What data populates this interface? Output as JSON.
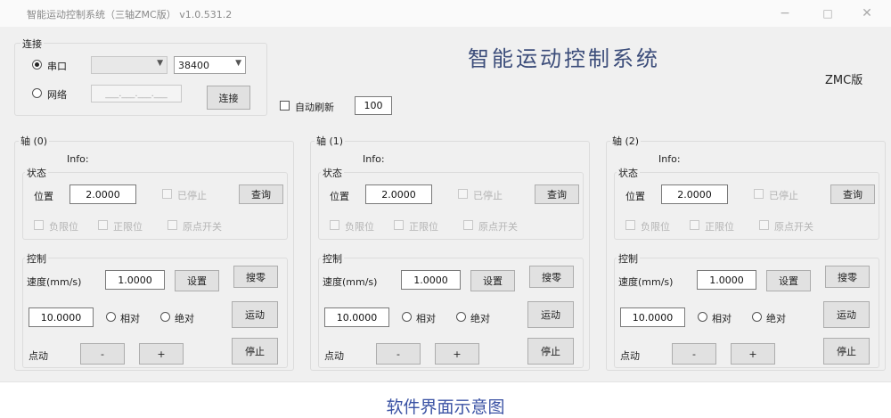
{
  "window": {
    "title": "智能运动控制系统（三轴ZMC版） v1.0.531.2",
    "minimize": "−",
    "maximize": "□",
    "close": "✕"
  },
  "header": {
    "system_name": "智能运动控制系统",
    "edition": "ZMC版"
  },
  "connection": {
    "group_label": "连接",
    "serial_label": "串口",
    "serial_selected": true,
    "port_value": "",
    "baud_value": "38400",
    "network_label": "网络",
    "ip_placeholder": "___.___.___.___",
    "connect_button": "连接"
  },
  "auto_refresh": {
    "label": "自动刷新",
    "checked": false,
    "interval": "100"
  },
  "axes": [
    {
      "title": "轴 (0)",
      "info_label": "Info:",
      "status_label": "状态",
      "position_label": "位置",
      "position_value": "2.0000",
      "stopped_label": "已停止",
      "query_button": "查询",
      "neg_limit_label": "负限位",
      "pos_limit_label": "正限位",
      "origin_switch_label": "原点开关",
      "control_label": "控制",
      "speed_label": "速度(mm/s)",
      "speed_value": "1.0000",
      "set_button": "设置",
      "home_button": "搜零",
      "distance_value": "10.0000",
      "relative_label": "相对",
      "absolute_label": "绝对",
      "move_button": "运动",
      "jog_label": "点动",
      "jog_minus": "-",
      "jog_plus": "+",
      "stop_button": "停止"
    },
    {
      "title": "轴 (1)",
      "info_label": "Info:",
      "status_label": "状态",
      "position_label": "位置",
      "position_value": "2.0000",
      "stopped_label": "已停止",
      "query_button": "查询",
      "neg_limit_label": "负限位",
      "pos_limit_label": "正限位",
      "origin_switch_label": "原点开关",
      "control_label": "控制",
      "speed_label": "速度(mm/s)",
      "speed_value": "1.0000",
      "set_button": "设置",
      "home_button": "搜零",
      "distance_value": "10.0000",
      "relative_label": "相对",
      "absolute_label": "绝对",
      "move_button": "运动",
      "jog_label": "点动",
      "jog_minus": "-",
      "jog_plus": "+",
      "stop_button": "停止"
    },
    {
      "title": "轴 (2)",
      "info_label": "Info:",
      "status_label": "状态",
      "position_label": "位置",
      "position_value": "2.0000",
      "stopped_label": "已停止",
      "query_button": "查询",
      "neg_limit_label": "负限位",
      "pos_limit_label": "正限位",
      "origin_switch_label": "原点开关",
      "control_label": "控制",
      "speed_label": "速度(mm/s)",
      "speed_value": "1.0000",
      "set_button": "设置",
      "home_button": "搜零",
      "distance_value": "10.0000",
      "relative_label": "相对",
      "absolute_label": "绝对",
      "move_button": "运动",
      "jog_label": "点动",
      "jog_minus": "-",
      "jog_plus": "+",
      "stop_button": "停止"
    }
  ],
  "caption": "软件界面示意图"
}
